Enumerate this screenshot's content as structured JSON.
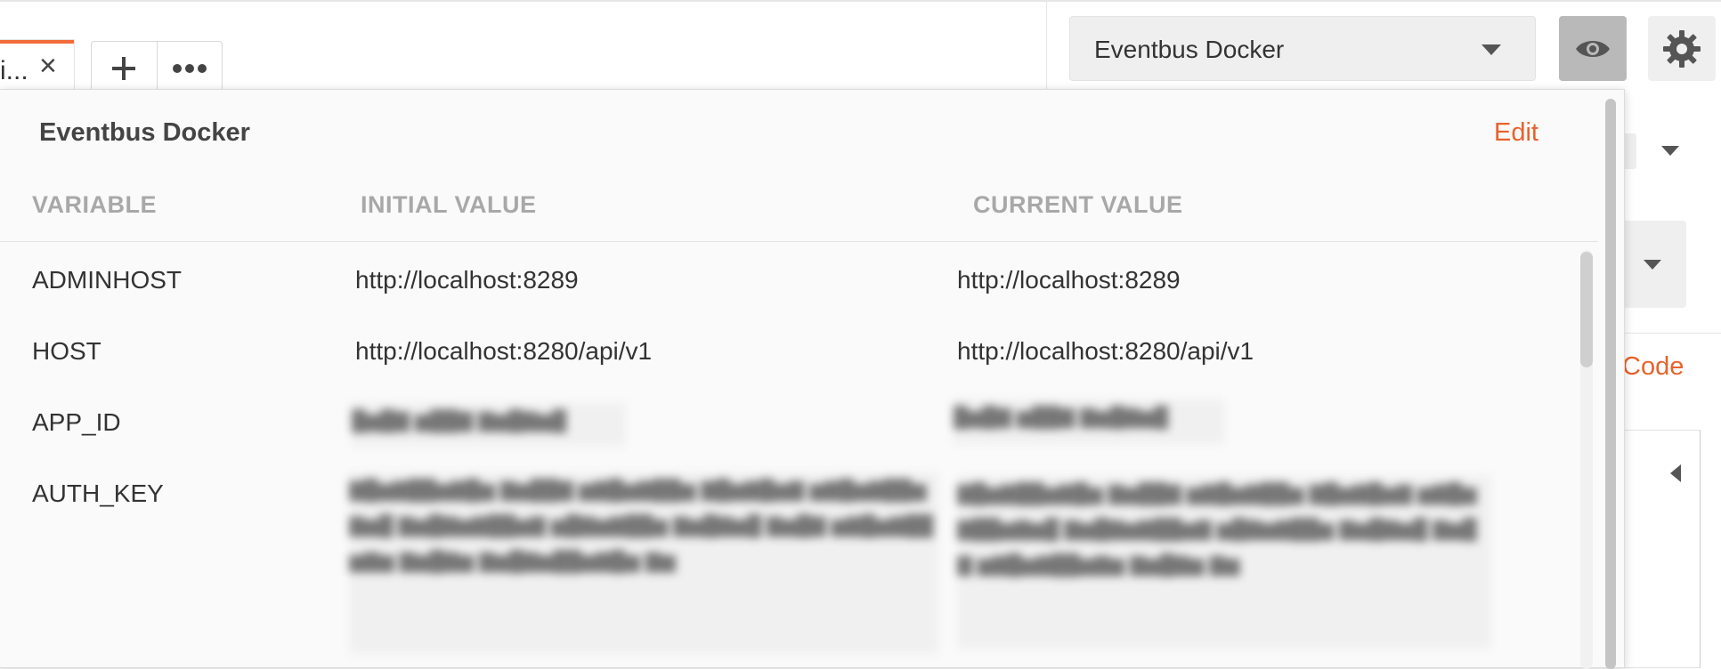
{
  "tab": {
    "label": "i...",
    "close": "×"
  },
  "tab_actions": {
    "add": "+",
    "more": "•••"
  },
  "env_select": {
    "label": "Eventbus Docker",
    "icon": "chevron-down-icon"
  },
  "quicklook": {
    "icon": "eye-icon",
    "active": true
  },
  "settings": {
    "icon": "gear-icon"
  },
  "right_panel": {
    "code_link": "Code"
  },
  "popover": {
    "title": "Eventbus Docker",
    "edit_label": "Edit",
    "columns": [
      "VARIABLE",
      "INITIAL VALUE",
      "CURRENT VALUE"
    ],
    "rows": [
      {
        "variable": "ADMINHOST",
        "initial": "http://localhost:8289",
        "current": "http://localhost:8289"
      },
      {
        "variable": "HOST",
        "initial": "http://localhost:8280/api/v1",
        "current": "http://localhost:8280/api/v1"
      },
      {
        "variable": "APP_ID",
        "initial": "",
        "current": ""
      },
      {
        "variable": "AUTH_KEY",
        "initial": "",
        "current": ""
      }
    ]
  },
  "colors": {
    "accent": "#e8622b",
    "tab_accent": "#f26b3a"
  }
}
